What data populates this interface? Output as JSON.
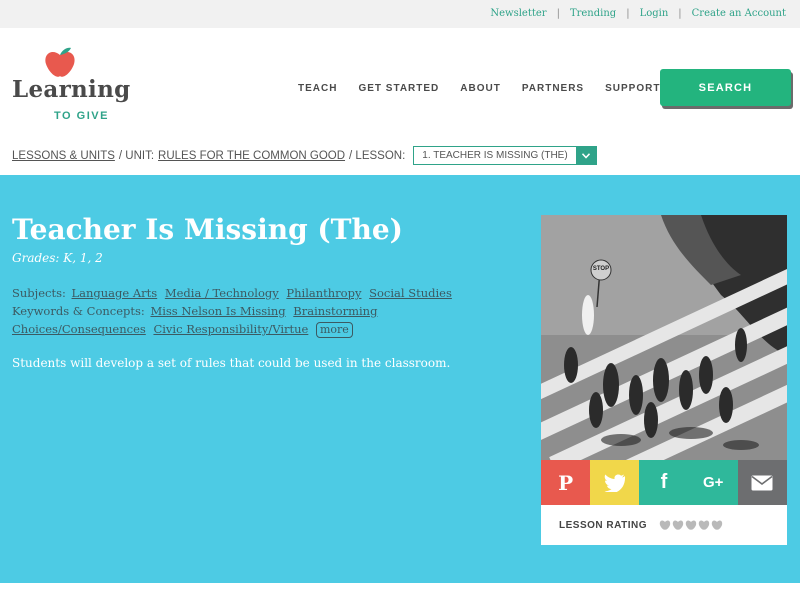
{
  "utility": {
    "links": [
      "Newsletter",
      "Trending",
      "Login",
      "Create an Account"
    ],
    "separator": "|"
  },
  "logo": {
    "word": "Learning",
    "sub": "TO GIVE"
  },
  "nav": {
    "items": [
      "TEACH",
      "GET STARTED",
      "ABOUT",
      "PARTNERS",
      "SUPPORT US"
    ],
    "search_label": "SEARCH"
  },
  "breadcrumb": {
    "lessons_units": "LESSONS & UNITS",
    "sep1": "/ UNIT:",
    "unit": "RULES FOR THE COMMON GOOD",
    "sep2": "/ LESSON:",
    "lesson_selected": "1. TEACHER IS MISSING (THE)"
  },
  "lesson": {
    "title": "Teacher Is Missing (The)",
    "grades": "Grades: K, 1, 2",
    "subjects_label": "Subjects:",
    "subjects": [
      "Language Arts",
      "Media / Technology",
      "Philanthropy",
      "Social Studies"
    ],
    "keywords_label": "Keywords & Concepts:",
    "keywords": [
      "Miss Nelson Is Missing",
      "Brainstorming",
      "Choices/Consequences",
      "Civic Responsibility/Virtue"
    ],
    "more_label": "more",
    "summary": "Students will develop a set of rules that could be used in the classroom."
  },
  "card": {
    "photo_sign": "STOP",
    "share": [
      {
        "icon": "pinterest-icon",
        "glyph": "P",
        "color": "#e8594e"
      },
      {
        "icon": "twitter-icon",
        "glyph": "t",
        "color": "#f1d74a"
      },
      {
        "icon": "facebook-icon",
        "glyph": "f",
        "color": "#2fb89b"
      },
      {
        "icon": "google-plus-icon",
        "glyph": "G+",
        "color": "#2fb89b"
      },
      {
        "icon": "email-icon",
        "glyph": "✉",
        "color": "#6d6e70"
      }
    ],
    "rating_label": "LESSON RATING",
    "rating_value": 0,
    "rating_max": 5
  },
  "colors": {
    "accent_green": "#23b47e",
    "link_teal": "#2fa389",
    "hero_blue": "#4dcbe4",
    "apple_red": "#e8594e"
  }
}
